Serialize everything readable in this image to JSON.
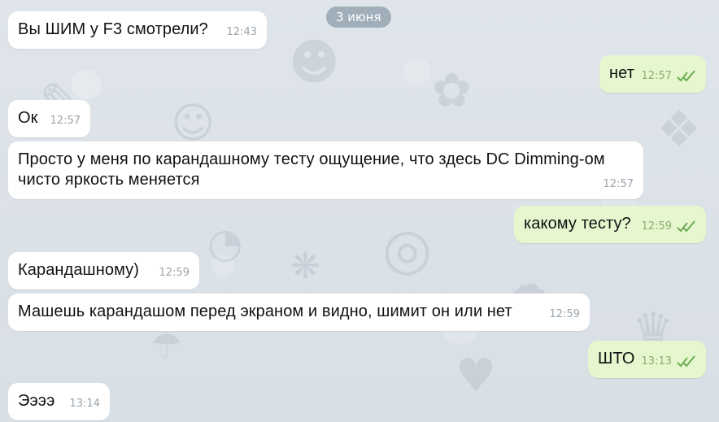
{
  "chat": {
    "date_badge": "3 июня",
    "messages": [
      {
        "direction": "incoming",
        "text": "Вы ШИМ у F3 смотрели?",
        "time": "12:43"
      },
      {
        "direction": "outgoing",
        "text": "нет",
        "time": "12:57",
        "read": true
      },
      {
        "direction": "incoming",
        "text": "Ок",
        "time": "12:57"
      },
      {
        "direction": "incoming",
        "text": "Просто у меня по карандашному тесту ощущение, что здесь DC Dimming-ом чисто яркость меняется",
        "time": "12:57"
      },
      {
        "direction": "outgoing",
        "text": "какому тесту?",
        "time": "12:59",
        "read": true
      },
      {
        "direction": "incoming",
        "text": "Карандашному)",
        "time": "12:59"
      },
      {
        "direction": "incoming",
        "text": "Машешь карандашом перед экраном и видно, шимит он или нет",
        "time": "12:59"
      },
      {
        "direction": "outgoing",
        "text": "ШТО",
        "time": "13:13",
        "read": true
      },
      {
        "direction": "incoming",
        "text": "Ээээ",
        "time": "13:14"
      }
    ]
  },
  "theme": {
    "incoming_bubble": "#ffffff",
    "outgoing_bubble": "#e6f6cf",
    "outgoing_check": "#6cad53",
    "wallpaper": "#dde3e8"
  },
  "icons": {
    "read_receipt": "double-check-icon"
  }
}
